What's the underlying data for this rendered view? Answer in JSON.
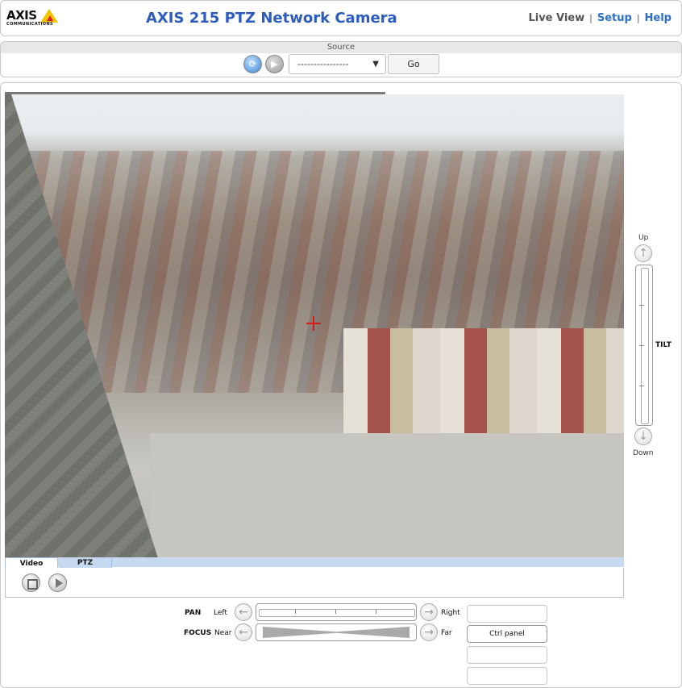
{
  "header": {
    "logo_text": "AXIS",
    "logo_sub": "COMMUNICATIONS",
    "title": "AXIS 215 PTZ Network Camera",
    "nav": {
      "live_view": "Live View",
      "setup": "Setup",
      "help": "Help",
      "separator": "|"
    }
  },
  "source": {
    "label": "Source",
    "select_value": "----------------",
    "go_label": "Go"
  },
  "video_tabs": {
    "video": "Video",
    "ptz": "PTZ"
  },
  "tilt": {
    "up_label": "Up",
    "name": "TILT",
    "down_label": "Down"
  },
  "pan": {
    "name": "PAN",
    "left_label": "Left",
    "right_label": "Right"
  },
  "focus": {
    "name": "FOCUS",
    "near_label": "Near",
    "far_label": "Far"
  },
  "ctrl_panel_label": "Ctrl panel",
  "colors": {
    "title_blue": "#2c5bbf",
    "link_blue": "#2c6ec9",
    "tab_blue": "#c6d9f1",
    "crosshair_red": "#d61a1a"
  }
}
